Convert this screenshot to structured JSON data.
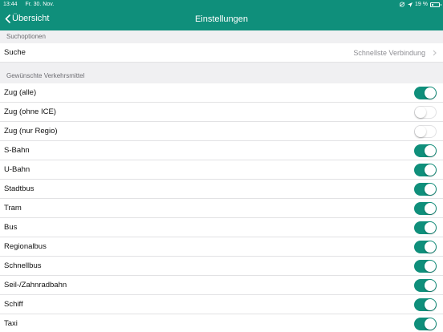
{
  "status_bar": {
    "time": "13:44",
    "date": "Fr. 30. Nov.",
    "battery": "19 %",
    "battery_level": 0.19
  },
  "nav": {
    "back_label": "Übersicht",
    "title": "Einstellungen"
  },
  "search_section": {
    "header": "Suchoptionen",
    "row": {
      "label": "Suche",
      "value": "Schnellste Verbindung"
    }
  },
  "transport_section": {
    "header": "Gewünschte Verkehrsmittel",
    "items": [
      {
        "label": "Zug (alle)",
        "on": true
      },
      {
        "label": "Zug (ohne ICE)",
        "on": false
      },
      {
        "label": "Zug (nur Regio)",
        "on": false
      },
      {
        "label": "S-Bahn",
        "on": true
      },
      {
        "label": "U-Bahn",
        "on": true
      },
      {
        "label": "Stadtbus",
        "on": true
      },
      {
        "label": "Tram",
        "on": true
      },
      {
        "label": "Bus",
        "on": true
      },
      {
        "label": "Regionalbus",
        "on": true
      },
      {
        "label": "Schnellbus",
        "on": true
      },
      {
        "label": "Seil-/Zahnradbahn",
        "on": true
      },
      {
        "label": "Schiff",
        "on": true
      },
      {
        "label": "Taxi",
        "on": true
      }
    ]
  },
  "colors": {
    "accent": "#0f8f7b",
    "background": "#f0f0f2"
  }
}
